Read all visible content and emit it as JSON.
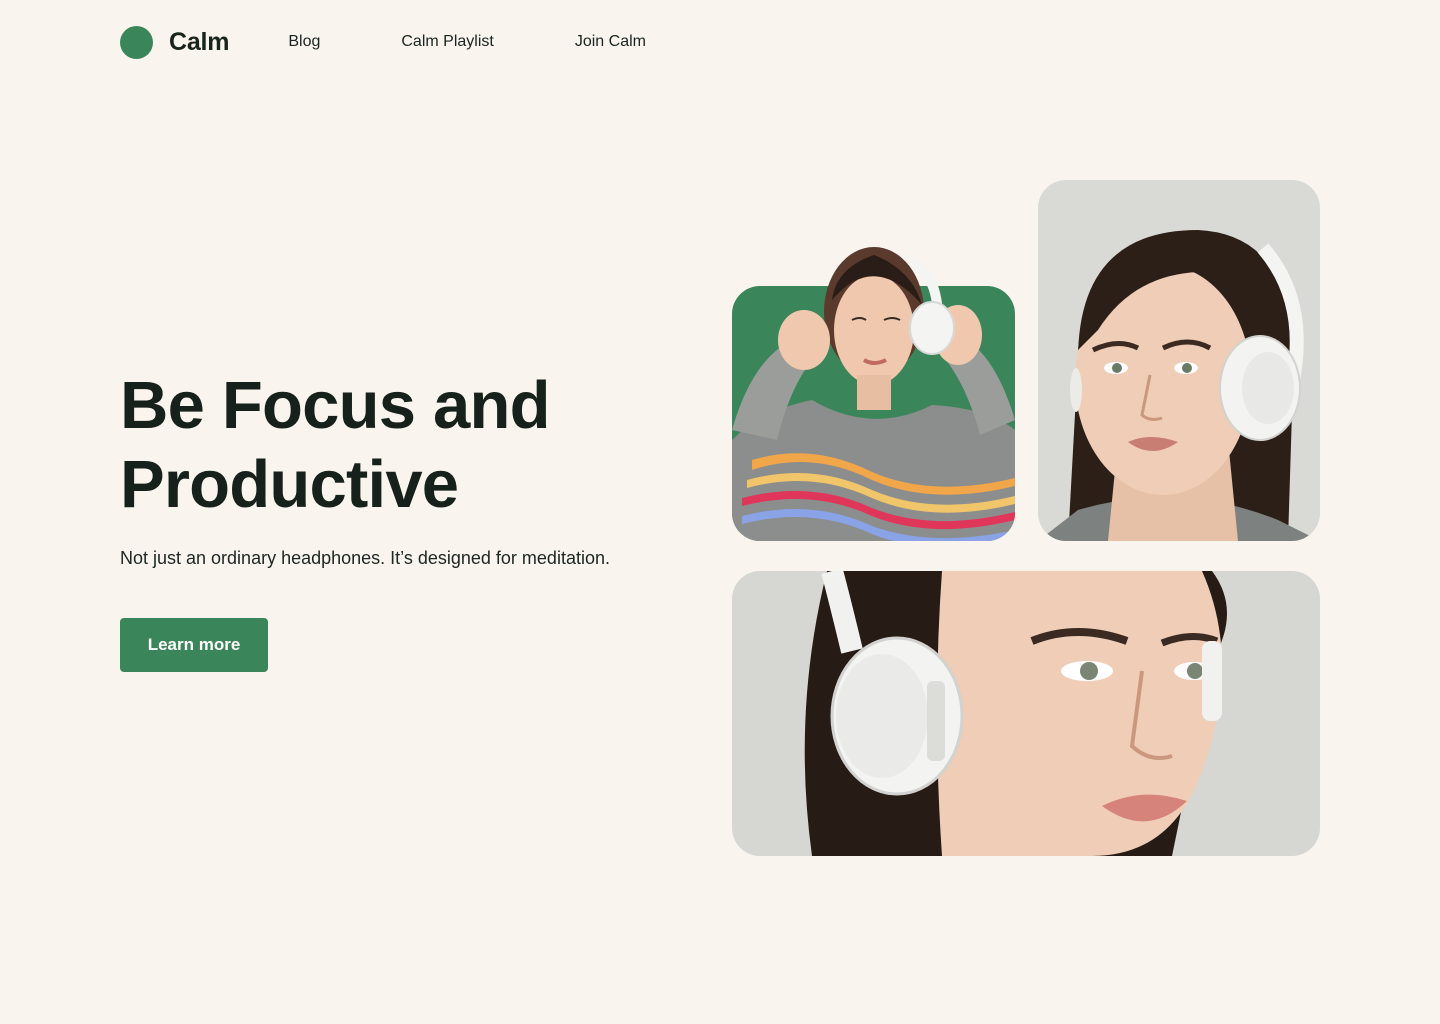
{
  "brand": {
    "name": "Calm",
    "color": "#3b855a"
  },
  "nav": {
    "links": [
      "Blog",
      "Calm Playlist",
      "Join Calm"
    ]
  },
  "hero": {
    "title_line1": "Be Focus and",
    "title_line2": "Productive",
    "subtitle": "Not just an ordinary headphones. It’s designed for meditation.",
    "cta_label": "Learn more"
  },
  "images": [
    {
      "name": "woman-with-headphones-green-background"
    },
    {
      "name": "woman-with-headphones-portrait"
    },
    {
      "name": "woman-with-headphones-closeup"
    }
  ]
}
